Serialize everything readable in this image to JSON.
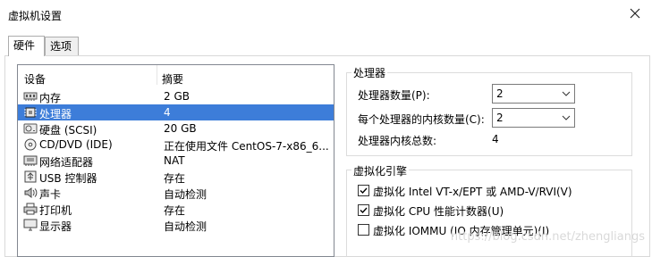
{
  "window": {
    "title": "虚拟机设置"
  },
  "tabs": [
    {
      "label": "硬件"
    },
    {
      "label": "选项"
    }
  ],
  "device_list": {
    "headers": {
      "device": "设备",
      "summary": "摘要"
    },
    "rows": [
      {
        "name": "内存",
        "summary": "2 GB",
        "icon": "memory-icon"
      },
      {
        "name": "处理器",
        "summary": "4",
        "icon": "processor-icon",
        "selected": true
      },
      {
        "name": "硬盘 (SCSI)",
        "summary": "20 GB",
        "icon": "harddisk-icon"
      },
      {
        "name": "CD/DVD (IDE)",
        "summary": "正在使用文件 CentOS-7-x86_6...",
        "icon": "cd-dvd-icon"
      },
      {
        "name": "网络适配器",
        "summary": "NAT",
        "icon": "network-adapter-icon"
      },
      {
        "name": "USB 控制器",
        "summary": "存在",
        "icon": "usb-icon"
      },
      {
        "name": "声卡",
        "summary": "自动检测",
        "icon": "sound-card-icon"
      },
      {
        "name": "打印机",
        "summary": "存在",
        "icon": "printer-icon"
      },
      {
        "name": "显示器",
        "summary": "自动检测",
        "icon": "display-icon"
      }
    ]
  },
  "processor": {
    "group_label": "处理器",
    "count_label": "处理器数量(P):",
    "count_value": "2",
    "cores_label": "每个处理器的内核数量(C):",
    "cores_value": "2",
    "total_label": "处理器内核总数:",
    "total_value": "4"
  },
  "virtualization": {
    "group_label": "虚拟化引擎",
    "options": [
      {
        "label": "虚拟化 Intel VT-x/EPT 或 AMD-V/RVI(V)",
        "checked": true
      },
      {
        "label": "虚拟化 CPU 性能计数器(U)",
        "checked": true
      },
      {
        "label": "虚拟化 IOMMU (IO 内存管理单元)(I)",
        "checked": false
      }
    ]
  },
  "watermark": "https://blog.csdn.net/zhengliangs",
  "colors": {
    "selection": "#3d7dd9",
    "check": "#000000"
  }
}
